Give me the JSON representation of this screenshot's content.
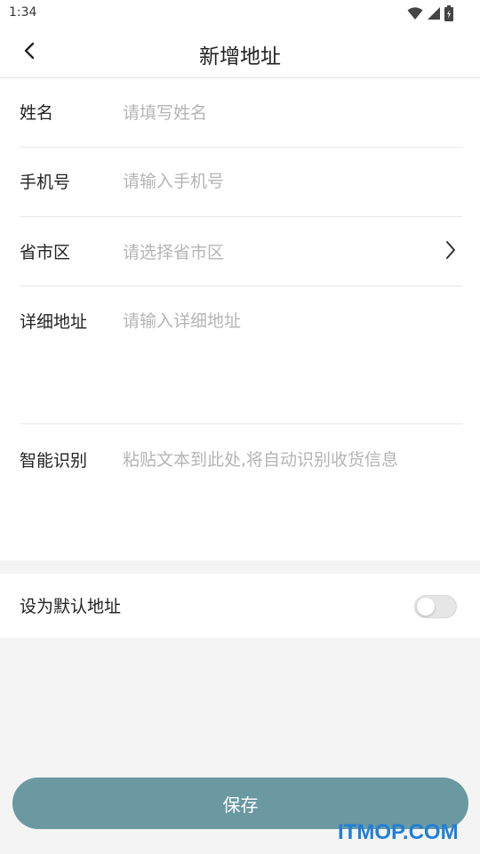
{
  "status_bar": {
    "time": "1:34",
    "icons": [
      "wifi-icon",
      "signal-icon",
      "battery-icon"
    ]
  },
  "nav": {
    "back_icon": "chevron-left-icon",
    "title": "新增地址"
  },
  "form": {
    "name": {
      "label": "姓名",
      "placeholder": "请填写姓名"
    },
    "phone": {
      "label": "手机号",
      "placeholder": "请输入手机号"
    },
    "region": {
      "label": "省市区",
      "placeholder": "请选择省市区",
      "arrow_icon": "chevron-right-icon"
    },
    "detail": {
      "label": "详细地址",
      "placeholder": "请输入详细地址"
    },
    "smart": {
      "label": "智能识别",
      "placeholder": "粘贴文本到此处,将自动识别收货信息"
    }
  },
  "default_address": {
    "label": "设为默认地址",
    "enabled": false
  },
  "save_button": {
    "label": "保存"
  },
  "watermark": "ITMOP.COM",
  "colors": {
    "primary_button": "#6a99a1",
    "placeholder": "#b5b5b5",
    "background": "#f4f4f4",
    "watermark": "#1f7fd8"
  }
}
